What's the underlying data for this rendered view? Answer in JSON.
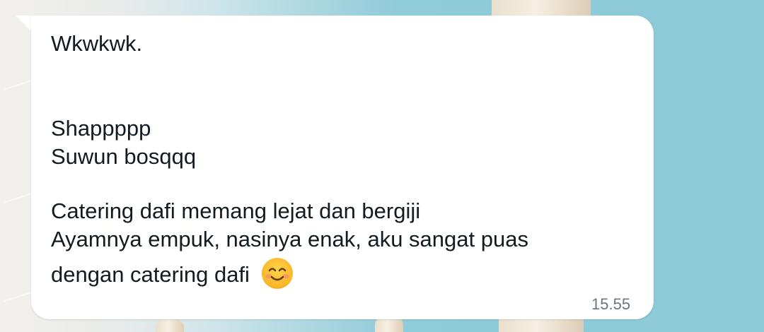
{
  "message": {
    "lines": [
      "Wkwkwk.",
      "Shappppp",
      "Suwun bosqqq",
      "Catering dafi memang lejat dan bergiji",
      "Ayamnya empuk, nasinya enak, aku sangat puas",
      "dengan catering dafi"
    ],
    "emoji": "smiling-face-icon",
    "time": "15.55"
  },
  "colors": {
    "bubble": "#ffffff",
    "text": "#111b21",
    "time": "#667781"
  }
}
